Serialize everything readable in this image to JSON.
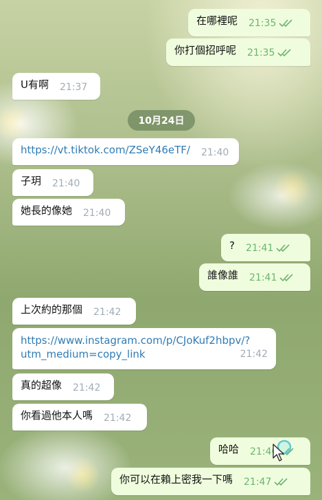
{
  "colors": {
    "outgoing_bubble": "#effdde",
    "incoming_bubble": "#ffffff",
    "link": "#2f7cb5",
    "outgoing_time": "#6db36f",
    "incoming_time": "#a0acb6"
  },
  "date_separator": "10月24日",
  "messages": [
    {
      "direction": "out",
      "text": "在哪裡呢",
      "time": "21:35",
      "status": "read"
    },
    {
      "direction": "out",
      "text": "你打個招呼呢",
      "time": "21:35",
      "status": "read"
    },
    {
      "direction": "in",
      "text": "U有啊",
      "time": "21:37"
    },
    {
      "direction": "in",
      "text": "https://vt.tiktok.com/ZSeY46eTF/",
      "time": "21:40",
      "is_link": true
    },
    {
      "direction": "in",
      "text": "子玥",
      "time": "21:40"
    },
    {
      "direction": "in",
      "text": "她長的像她",
      "time": "21:40"
    },
    {
      "direction": "out",
      "text": "?",
      "time": "21:41",
      "status": "read"
    },
    {
      "direction": "out",
      "text": "誰像誰",
      "time": "21:41",
      "status": "read"
    },
    {
      "direction": "in",
      "text": "上次約的那個",
      "time": "21:42"
    },
    {
      "direction": "in",
      "text_line1": "https://www.instagram.com/p/CJoKuf2hbpv/?",
      "text_line2": "utm_medium=copy_link",
      "time": "21:42",
      "is_link": true
    },
    {
      "direction": "in",
      "text": "真的超像",
      "time": "21:42"
    },
    {
      "direction": "in",
      "text": "你看過他本人嗎",
      "time": "21:42"
    },
    {
      "direction": "out",
      "text": "哈哈",
      "time": "21:46",
      "status": "read"
    },
    {
      "direction": "out",
      "text": "你可以在賴上密我一下嗎",
      "time": "21:47",
      "status": "read"
    }
  ],
  "icons": {
    "read_status": "double-check-icon",
    "pointer": "mouse-cursor-icon"
  }
}
